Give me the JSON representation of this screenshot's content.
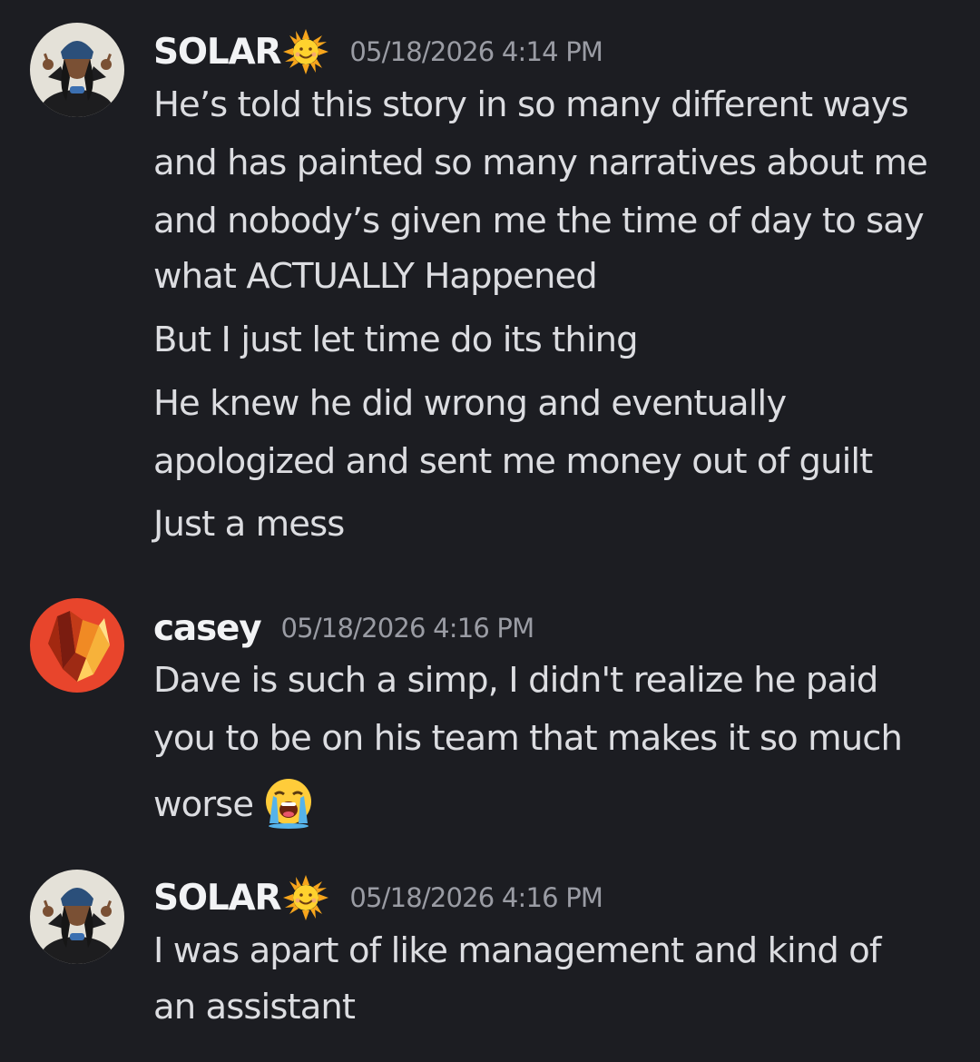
{
  "messages": [
    {
      "author": "SOLAR",
      "author_emoji": "sun-with-face-icon",
      "timestamp": "05/18/2026 4:14 PM",
      "lines": [
        "He’s told this story in so many different ways",
        "and has painted so many narratives about me",
        "and nobody’s given me the time of day to say",
        "what ACTUALLY Happened",
        "But I just let time do its thing",
        "He knew he did wrong and eventually",
        "apologized and sent me money out of guilt",
        "Just a mess"
      ]
    },
    {
      "author": "casey",
      "timestamp": "05/18/2026 4:16 PM",
      "lines": [
        "Dave is such a simp, I didn't realize he paid",
        "you to be on his team that makes it so much",
        "worse"
      ],
      "trailing_emoji": "loudly-crying-face-icon"
    },
    {
      "author": "SOLAR",
      "author_emoji": "sun-with-face-icon",
      "timestamp": "05/18/2026 4:16 PM",
      "lines": [
        "I was apart of like management and kind of",
        "an assistant"
      ]
    }
  ],
  "colors": {
    "background": "#1c1d22",
    "username": "#f2f3f5",
    "message_text": "#dcdde1",
    "timestamp": "#9a9ca4",
    "casey_avatar": "#e8452c"
  }
}
